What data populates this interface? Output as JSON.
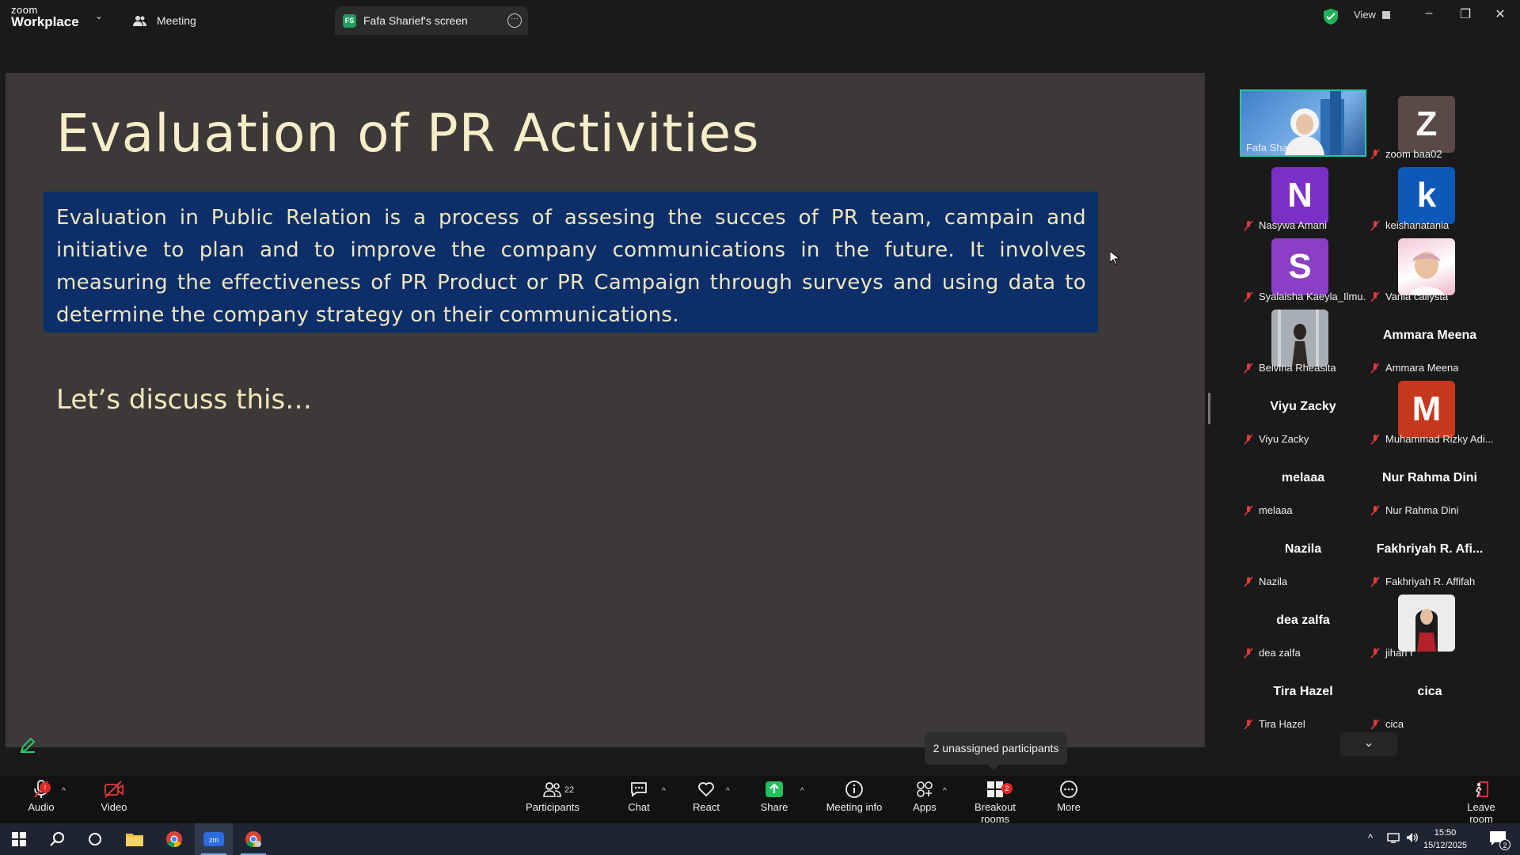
{
  "app": {
    "brand_top": "zoom",
    "brand_bottom": "Workplace"
  },
  "tabs": {
    "meeting": "Meeting",
    "screen": "Fafa Sharief's screen",
    "screen_badge": "FS"
  },
  "titlebar": {
    "view_label": "View"
  },
  "slide": {
    "title": "Evaluation of PR Activities",
    "body": "Evaluation in Public Relation is a process of assesing the succes of PR team, campain and initiative to plan and to improve the company communications in the future. It involves measuring the effectiveness of PR Product or PR Campaign through surveys and using data to determine the company strategy on their communications.",
    "subtitle": "Let’s discuss this…"
  },
  "participants": [
    {
      "label": "Fafa Sharief",
      "type": "photo"
    },
    {
      "label": "zoom baa02",
      "type": "letter",
      "letter": "Z",
      "color": "#5a4a47"
    },
    {
      "label": "Nasywa Amani",
      "type": "letter",
      "letter": "N",
      "color": "#7b2fc7"
    },
    {
      "label": "keishanatania",
      "type": "letter",
      "letter": "k",
      "color": "#0d59b8"
    },
    {
      "label": "Syalaisha Kaeyla_Ilmu...",
      "type": "letter",
      "letter": "S",
      "color": "#8a3fc4"
    },
    {
      "label": "Vania callysta",
      "type": "photo"
    },
    {
      "label": "Belvina Rheasita",
      "type": "photo"
    },
    {
      "label": "Ammara Meena",
      "type": "name",
      "name": "Ammara Meena"
    },
    {
      "label": "Viyu Zacky",
      "type": "name",
      "name": "Viyu Zacky"
    },
    {
      "label": "Muhammad Rizky Adi...",
      "type": "letter",
      "letter": "M",
      "color": "#c5381d"
    },
    {
      "label": "melaaa",
      "type": "name",
      "name": "melaaa"
    },
    {
      "label": "Nur Rahma Dini",
      "type": "name",
      "name": "Nur Rahma Dini"
    },
    {
      "label": "Nazila",
      "type": "name",
      "name": "Nazila"
    },
    {
      "label": "Fakhriyah R. Affifah",
      "type": "name",
      "name": "Fakhriyah R. Afi..."
    },
    {
      "label": "dea zalfa",
      "type": "name",
      "name": "dea zalfa"
    },
    {
      "label": "jihan r",
      "type": "photo"
    },
    {
      "label": "Tira Hazel",
      "type": "name",
      "name": "Tira Hazel"
    },
    {
      "label": "cica",
      "type": "name",
      "name": "cica"
    }
  ],
  "unassigned": "2 unassigned participants",
  "toolbar": {
    "audio": "Audio",
    "video": "Video",
    "participants": "Participants",
    "participants_count": "22",
    "chat": "Chat",
    "react": "React",
    "share": "Share",
    "meeting_info": "Meeting info",
    "apps": "Apps",
    "breakout": "Breakout rooms",
    "breakout_badge": "2",
    "more": "More",
    "leave": "Leave room"
  },
  "taskbar": {
    "time": "15:50",
    "date": "15/12/2025",
    "notif_count": "2"
  },
  "colors": {
    "slide_bg": "#3d3938",
    "slide_box": "#0c2f6a",
    "slide_text": "#f1e6bc",
    "accent_active": "#24c8a4",
    "share_green": "#1fc15b"
  }
}
